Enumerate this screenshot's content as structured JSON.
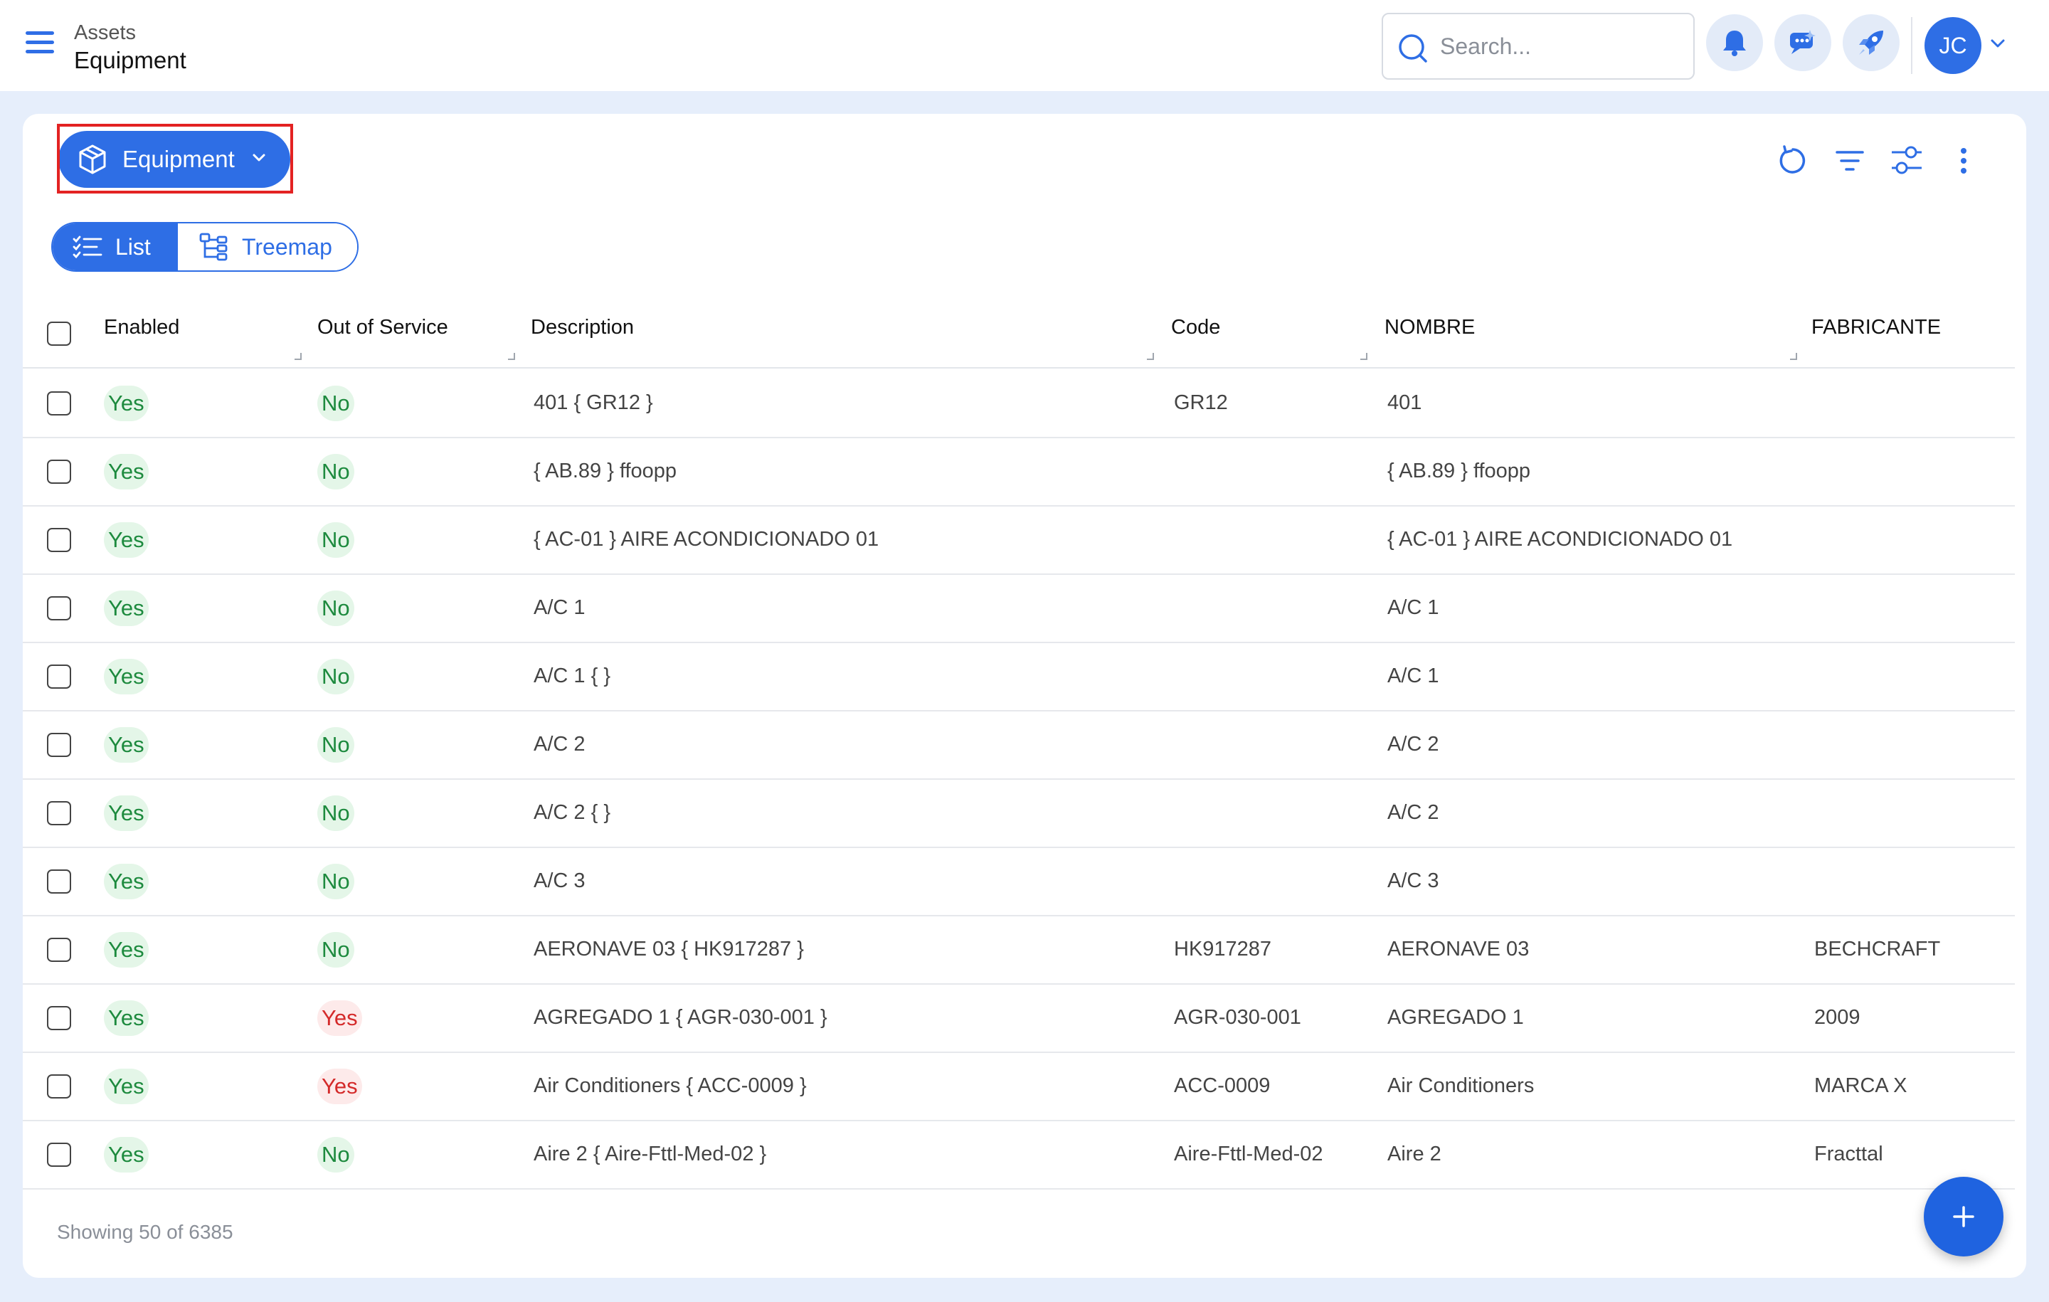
{
  "header": {
    "breadcrumb_parent": "Assets",
    "page_title": "Equipment",
    "search_placeholder": "Search...",
    "avatar_initials": "JC"
  },
  "card": {
    "module_button_label": "Equipment",
    "view_toggle": {
      "list_label": "List",
      "treemap_label": "Treemap",
      "active": "List"
    },
    "toolbar_icons": [
      "refresh-icon",
      "filter-icon",
      "column-settings-icon",
      "more-vertical-icon"
    ]
  },
  "table": {
    "columns": [
      "Enabled",
      "Out of Service",
      "Description",
      "Code",
      "NOMBRE",
      "FABRICANTE"
    ],
    "rows": [
      {
        "enabled": "Yes",
        "out_of_service": "No",
        "description": "401 { GR12 }",
        "code": "GR12",
        "nombre": "401",
        "fabricante": ""
      },
      {
        "enabled": "Yes",
        "out_of_service": "No",
        "description": "{ AB.89 } ffoopp",
        "code": "",
        "nombre": "{ AB.89 } ffoopp",
        "fabricante": ""
      },
      {
        "enabled": "Yes",
        "out_of_service": "No",
        "description": "{ AC-01 } AIRE ACONDICIONADO 01",
        "code": "",
        "nombre": "{ AC-01 } AIRE ACONDICIONADO 01",
        "fabricante": ""
      },
      {
        "enabled": "Yes",
        "out_of_service": "No",
        "description": "A/C 1",
        "code": "",
        "nombre": "A/C 1",
        "fabricante": ""
      },
      {
        "enabled": "Yes",
        "out_of_service": "No",
        "description": "A/C 1 { }",
        "code": "",
        "nombre": "A/C 1",
        "fabricante": ""
      },
      {
        "enabled": "Yes",
        "out_of_service": "No",
        "description": "A/C 2",
        "code": "",
        "nombre": "A/C 2",
        "fabricante": ""
      },
      {
        "enabled": "Yes",
        "out_of_service": "No",
        "description": "A/C 2 { }",
        "code": "",
        "nombre": "A/C 2",
        "fabricante": ""
      },
      {
        "enabled": "Yes",
        "out_of_service": "No",
        "description": "A/C 3",
        "code": "",
        "nombre": "A/C 3",
        "fabricante": ""
      },
      {
        "enabled": "Yes",
        "out_of_service": "No",
        "description": "AERONAVE 03 { HK917287 }",
        "code": "HK917287",
        "nombre": "AERONAVE 03",
        "fabricante": "BECHCRAFT"
      },
      {
        "enabled": "Yes",
        "out_of_service": "Yes",
        "description": "AGREGADO 1 { AGR-030-001 }",
        "code": "AGR-030-001",
        "nombre": "AGREGADO 1",
        "fabricante": "2009"
      },
      {
        "enabled": "Yes",
        "out_of_service": "Yes",
        "description": "Air Conditioners { ACC-0009 }",
        "code": "ACC-0009",
        "nombre": "Air Conditioners",
        "fabricante": "MARCA X"
      },
      {
        "enabled": "Yes",
        "out_of_service": "No",
        "description": "Aire 2 { Aire-Fttl-Med-02 }",
        "code": "Aire-Fttl-Med-02",
        "nombre": "Aire 2",
        "fabricante": "Fracttal"
      }
    ]
  },
  "footer": {
    "showing_text": "Showing 50 of 6385"
  },
  "colors": {
    "accent": "#2e6ee5",
    "positive": "#1d8a3e",
    "negative": "#d42a2a",
    "highlight": "#e32222"
  }
}
